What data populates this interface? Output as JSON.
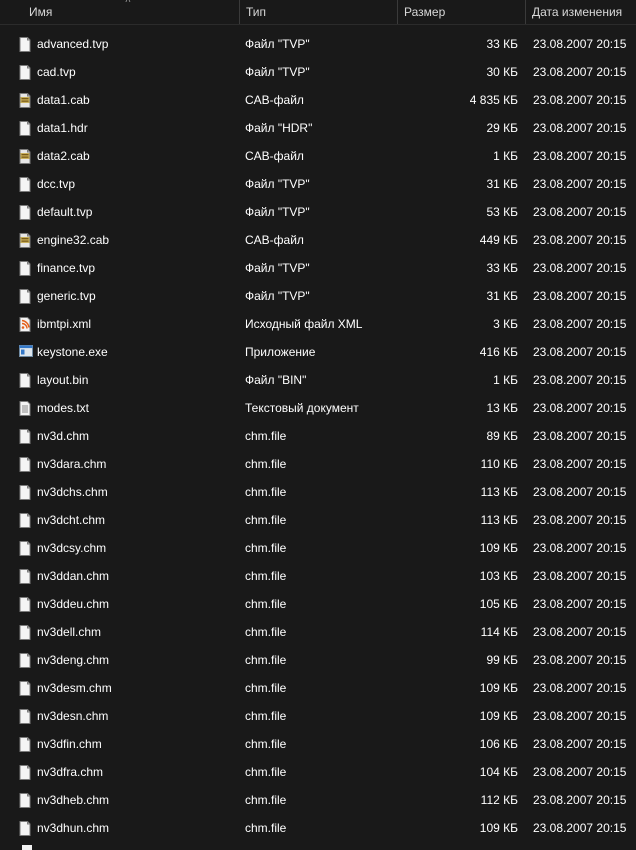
{
  "columns": {
    "name": "Имя",
    "type": "Тип",
    "size": "Размер",
    "date": "Дата изменения"
  },
  "sort_indicator": "chevron-up-icon",
  "files": [
    {
      "name": "advanced.tvp",
      "type": "Файл \"TVP\"",
      "size": "33 КБ",
      "date": "23.08.2007 20:15",
      "icon": "file-icon"
    },
    {
      "name": "cad.tvp",
      "type": "Файл \"TVP\"",
      "size": "30 КБ",
      "date": "23.08.2007 20:15",
      "icon": "file-icon"
    },
    {
      "name": "data1.cab",
      "type": "CAB-файл",
      "size": "4 835 КБ",
      "date": "23.08.2007 20:15",
      "icon": "cab-archive-icon"
    },
    {
      "name": "data1.hdr",
      "type": "Файл \"HDR\"",
      "size": "29 КБ",
      "date": "23.08.2007 20:15",
      "icon": "file-icon"
    },
    {
      "name": "data2.cab",
      "type": "CAB-файл",
      "size": "1 КБ",
      "date": "23.08.2007 20:15",
      "icon": "cab-archive-icon"
    },
    {
      "name": "dcc.tvp",
      "type": "Файл \"TVP\"",
      "size": "31 КБ",
      "date": "23.08.2007 20:15",
      "icon": "file-icon"
    },
    {
      "name": "default.tvp",
      "type": "Файл \"TVP\"",
      "size": "53 КБ",
      "date": "23.08.2007 20:15",
      "icon": "file-icon"
    },
    {
      "name": "engine32.cab",
      "type": "CAB-файл",
      "size": "449 КБ",
      "date": "23.08.2007 20:15",
      "icon": "cab-archive-icon"
    },
    {
      "name": "finance.tvp",
      "type": "Файл \"TVP\"",
      "size": "33 КБ",
      "date": "23.08.2007 20:15",
      "icon": "file-icon"
    },
    {
      "name": "generic.tvp",
      "type": "Файл \"TVP\"",
      "size": "31 КБ",
      "date": "23.08.2007 20:15",
      "icon": "file-icon"
    },
    {
      "name": "ibmtpi.xml",
      "type": "Исходный файл XML",
      "size": "3 КБ",
      "date": "23.08.2007 20:15",
      "icon": "xml-file-icon"
    },
    {
      "name": "keystone.exe",
      "type": "Приложение",
      "size": "416 КБ",
      "date": "23.08.2007 20:15",
      "icon": "application-icon"
    },
    {
      "name": "layout.bin",
      "type": "Файл \"BIN\"",
      "size": "1 КБ",
      "date": "23.08.2007 20:15",
      "icon": "file-icon"
    },
    {
      "name": "modes.txt",
      "type": "Текстовый документ",
      "size": "13 КБ",
      "date": "23.08.2007 20:15",
      "icon": "text-file-icon"
    },
    {
      "name": "nv3d.chm",
      "type": "chm.file",
      "size": "89 КБ",
      "date": "23.08.2007 20:15",
      "icon": "file-icon"
    },
    {
      "name": "nv3dara.chm",
      "type": "chm.file",
      "size": "110 КБ",
      "date": "23.08.2007 20:15",
      "icon": "file-icon"
    },
    {
      "name": "nv3dchs.chm",
      "type": "chm.file",
      "size": "113 КБ",
      "date": "23.08.2007 20:15",
      "icon": "file-icon"
    },
    {
      "name": "nv3dcht.chm",
      "type": "chm.file",
      "size": "113 КБ",
      "date": "23.08.2007 20:15",
      "icon": "file-icon"
    },
    {
      "name": "nv3dcsy.chm",
      "type": "chm.file",
      "size": "109 КБ",
      "date": "23.08.2007 20:15",
      "icon": "file-icon"
    },
    {
      "name": "nv3ddan.chm",
      "type": "chm.file",
      "size": "103 КБ",
      "date": "23.08.2007 20:15",
      "icon": "file-icon"
    },
    {
      "name": "nv3ddeu.chm",
      "type": "chm.file",
      "size": "105 КБ",
      "date": "23.08.2007 20:15",
      "icon": "file-icon"
    },
    {
      "name": "nv3dell.chm",
      "type": "chm.file",
      "size": "114 КБ",
      "date": "23.08.2007 20:15",
      "icon": "file-icon"
    },
    {
      "name": "nv3deng.chm",
      "type": "chm.file",
      "size": "99 КБ",
      "date": "23.08.2007 20:15",
      "icon": "file-icon"
    },
    {
      "name": "nv3desm.chm",
      "type": "chm.file",
      "size": "109 КБ",
      "date": "23.08.2007 20:15",
      "icon": "file-icon"
    },
    {
      "name": "nv3desn.chm",
      "type": "chm.file",
      "size": "109 КБ",
      "date": "23.08.2007 20:15",
      "icon": "file-icon"
    },
    {
      "name": "nv3dfin.chm",
      "type": "chm.file",
      "size": "106 КБ",
      "date": "23.08.2007 20:15",
      "icon": "file-icon"
    },
    {
      "name": "nv3dfra.chm",
      "type": "chm.file",
      "size": "104 КБ",
      "date": "23.08.2007 20:15",
      "icon": "file-icon"
    },
    {
      "name": "nv3dheb.chm",
      "type": "chm.file",
      "size": "112 КБ",
      "date": "23.08.2007 20:15",
      "icon": "file-icon"
    },
    {
      "name": "nv3dhun.chm",
      "type": "chm.file",
      "size": "109 КБ",
      "date": "23.08.2007 20:15",
      "icon": "file-icon"
    }
  ]
}
